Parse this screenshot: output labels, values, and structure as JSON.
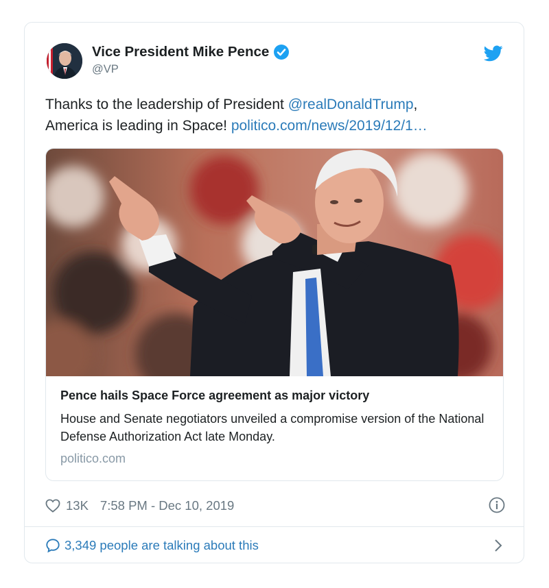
{
  "tweet": {
    "author": {
      "display_name": "Vice President Mike Pence",
      "handle": "@VP",
      "verified": true
    },
    "text_prefix": "Thanks to the leadership of President ",
    "mention": "@realDonaldTrump",
    "text_middle": ",",
    "text_line2": "America is leading in Space! ",
    "url": "politico.com/news/2019/12/1…",
    "card": {
      "title": "Pence hails Space Force agreement as major victory",
      "description": "House and Senate negotiators unveiled a compromise version of the National Defense Authorization Act late Monday.",
      "domain": "politico.com"
    },
    "likes": "13K",
    "timestamp": "7:58 PM - Dec 10, 2019",
    "talking": "3,349 people are talking about this"
  },
  "colors": {
    "link": "#2b7bb9",
    "twitter_blue": "#1da1f2",
    "muted": "#697882",
    "border": "#e1e8ed"
  },
  "icons": [
    "avatar",
    "verified-badge-icon",
    "twitter-bird-icon",
    "heart-icon",
    "info-icon",
    "reply-bubble-icon",
    "chevron-right-icon"
  ]
}
